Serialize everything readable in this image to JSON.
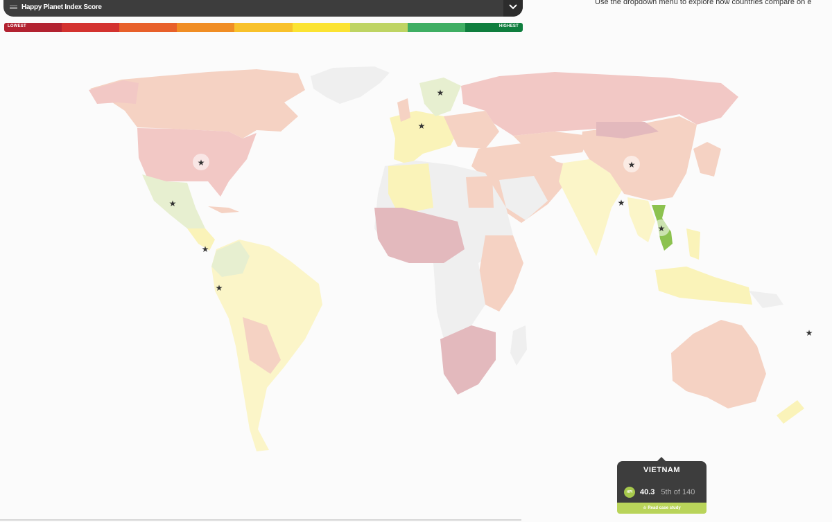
{
  "dropdown": {
    "label": "Happy Planet Index Score",
    "icon": "bars-icon",
    "toggle_icon": "chevron-down-icon"
  },
  "instructions": "Use the dropdown menu to explore how  countries compare on e",
  "legend": {
    "low_label": "LOWEST",
    "high_label": "HIGHEST",
    "colors": [
      "#b22230",
      "#d3322f",
      "#e8602a",
      "#f08d24",
      "#f8c12b",
      "#fbe332",
      "#bed463",
      "#3fae63",
      "#0f7e3e"
    ]
  },
  "map": {
    "marker_icon": "star-icon",
    "marker_count": 12,
    "colors": {
      "ocean": "#fbfbfb",
      "pink": "#f2c8c5",
      "salmon": "#f5d2c3",
      "yellow": "#faf3b9",
      "paleyellow": "#fbf5c8",
      "grey": "#efefef",
      "green": "#8cc24f",
      "palegreen": "#e7efd0",
      "mauve": "#e3b9bd"
    }
  },
  "tooltip": {
    "country": "VIETNAM",
    "badge": "HPI",
    "score": "40.3",
    "rank": "5th of 140",
    "link": "☆ Read case study"
  }
}
